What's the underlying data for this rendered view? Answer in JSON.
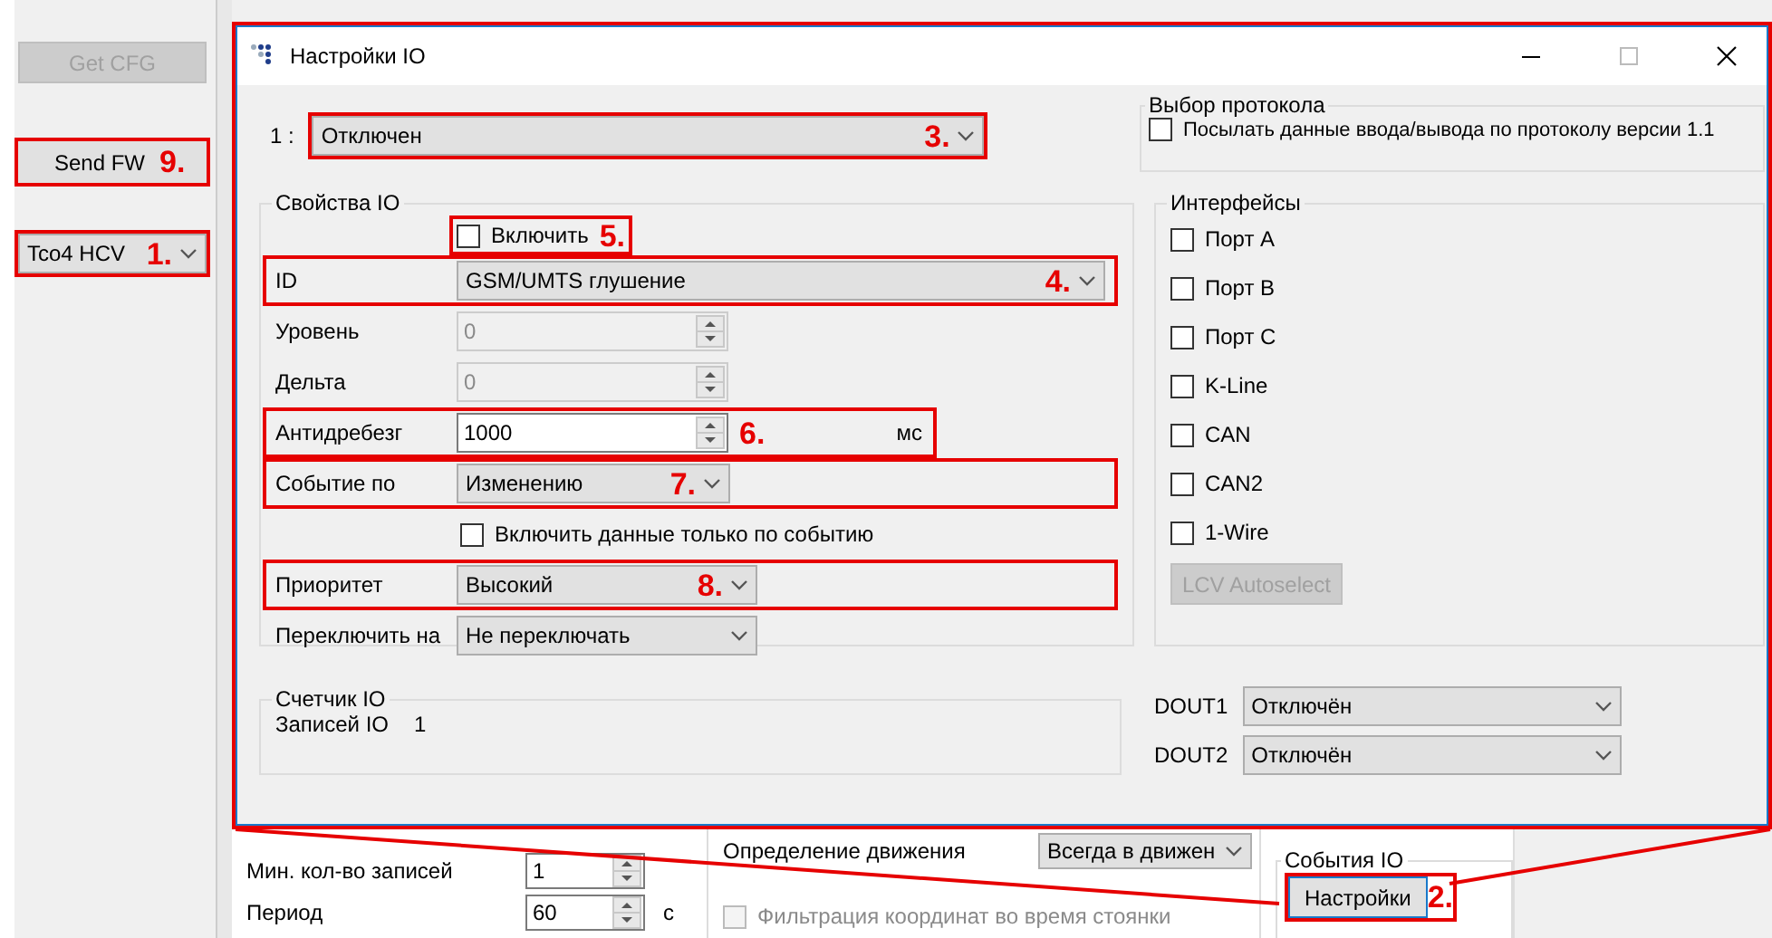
{
  "background_app": {
    "buttons": [
      {
        "label": "Get CFG",
        "disabled": true
      },
      {
        "label": "Send FW",
        "disabled": false,
        "marker": "9."
      }
    ],
    "model_select": {
      "value": "Tco4 HCV",
      "marker": "1."
    },
    "records": [
      {
        "label": "Мин. кол-во записей",
        "value": "1"
      },
      {
        "label": "Период",
        "value": "60",
        "unit": "с"
      }
    ],
    "motion": {
      "label": "Определение движения",
      "value": "Всегда в движен"
    },
    "parking_filter": {
      "label": "Фильтрация координат во время стоянки",
      "checked": false,
      "disabled": true
    },
    "io_events": {
      "title": "События IO",
      "button": "Настройки",
      "marker": "2."
    }
  },
  "dialog": {
    "title": "Настройки IO",
    "io_select": {
      "label": "1 :",
      "value": "Отключен",
      "marker": "3."
    },
    "protocol": {
      "title": "Выбор протокола",
      "checkbox": {
        "label": "Посылать данные ввода/вывода по протоколу версии 1.1",
        "checked": false
      }
    },
    "io_properties": {
      "title": "Свойства IO",
      "enable": {
        "label": "Включить",
        "checked": false,
        "marker": "5."
      },
      "fields": [
        {
          "kind": "combo",
          "label": "ID",
          "value": "GSM/UMTS глушение",
          "marker": "4."
        },
        {
          "kind": "spin",
          "label": "Уровень",
          "value": "0",
          "disabled": true
        },
        {
          "kind": "spin",
          "label": "Дельта",
          "value": "0",
          "disabled": true
        },
        {
          "kind": "spin",
          "label": "Антидребезг",
          "value": "1000",
          "unit": "мс",
          "marker": "6.",
          "disabled": false
        },
        {
          "kind": "combo",
          "label": "Событие по",
          "value": "Изменению",
          "marker": "7."
        },
        {
          "kind": "checkbox",
          "label": "Включить данные только по событию",
          "checked": false
        },
        {
          "kind": "combo",
          "label": "Приоритет",
          "value": "Высокий",
          "marker": "8."
        },
        {
          "kind": "combo",
          "label": "Переключить на",
          "value": "Не переключать"
        }
      ]
    },
    "interfaces": {
      "title": "Интерфейсы",
      "items": [
        {
          "label": "Порт A",
          "checked": false
        },
        {
          "label": "Порт B",
          "checked": false
        },
        {
          "label": "Порт C",
          "checked": false
        },
        {
          "label": "K-Line",
          "checked": false
        },
        {
          "label": "CAN",
          "checked": false
        },
        {
          "label": "CAN2",
          "checked": false
        },
        {
          "label": "1-Wire",
          "checked": false
        }
      ],
      "button": {
        "label": "LCV Autoselect",
        "disabled": true
      }
    },
    "io_counter": {
      "title": "Счетчик IO",
      "label": "Записей IO",
      "value": "1"
    },
    "outputs": [
      {
        "label": "DOUT1",
        "value": "Отключён"
      },
      {
        "label": "DOUT2",
        "value": "Отключён"
      }
    ]
  }
}
